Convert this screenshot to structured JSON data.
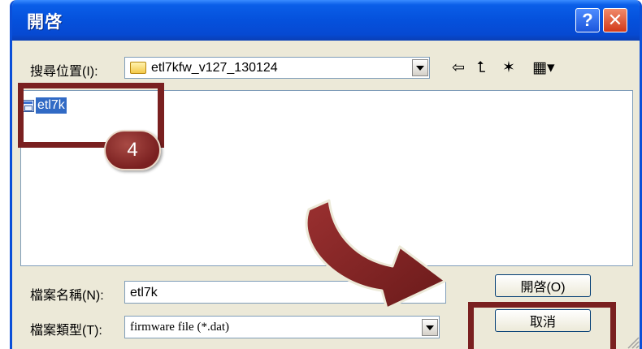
{
  "dialog": {
    "title": "開啓",
    "help_glyph": "?",
    "close_glyph": "✕"
  },
  "look_in": {
    "label": "搜尋位置(I):",
    "value": "etl7kfw_v127_130124"
  },
  "toolbar": {
    "back_glyph": "⇦",
    "up_glyph": "⮤",
    "new_folder_glyph": "✶",
    "view_glyph": "▦▾"
  },
  "file_list": {
    "items": [
      {
        "name": "etl7k",
        "icon": "firmware-file-icon",
        "selected": true
      }
    ]
  },
  "file_name": {
    "label": "檔案名稱(N):",
    "value": "etl7k"
  },
  "file_type": {
    "label": "檔案類型(T):",
    "value": "firmware file (*.dat)"
  },
  "buttons": {
    "open": "開啓(O)",
    "cancel": "取消"
  },
  "annotation": {
    "step_number": "4",
    "color": "#7a2020"
  },
  "colors": {
    "titlebar": "#0551dc",
    "dialog_bg": "#ece9d8",
    "selection": "#316ac5"
  }
}
